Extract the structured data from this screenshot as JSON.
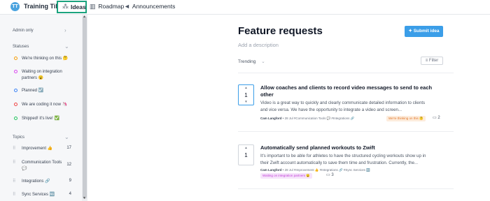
{
  "topbar": {
    "logo": "TT",
    "brand": "Training Tilt",
    "nav": [
      {
        "label": "Ideas",
        "icon": "sparkle-icon"
      },
      {
        "label": "Roadmap",
        "icon": "map-icon"
      },
      {
        "label": "Announcements",
        "icon": "megaphone-icon"
      }
    ]
  },
  "sidebar": {
    "admin_label": "Admin only",
    "statuses_title": "Statuses",
    "statuses": [
      {
        "label": "We're thinking on this 🤔",
        "color": "#f59e0b"
      },
      {
        "label": "Waiting on integration partners 😮",
        "color": "#d946ef"
      },
      {
        "label": "Planned ☑️",
        "color": "#3b82f6"
      },
      {
        "label": "We are coding it now 🦄",
        "color": "#ef4444"
      },
      {
        "label": "Shipped! it's live! ✅",
        "color": "#22c55e"
      }
    ],
    "topics_title": "Topics",
    "topics": [
      {
        "label": "Improvement 👍",
        "count": "17"
      },
      {
        "label": "Communication Tools 💬",
        "count": "12"
      },
      {
        "label": "Integrations 🔗",
        "count": "9"
      },
      {
        "label": "Sync Services 🆖",
        "count": "4"
      }
    ]
  },
  "main": {
    "title": "Feature requests",
    "description": "Add a description",
    "submit_label": "Submit idea",
    "sort_label": "Trending",
    "filter_label": "Filter",
    "posts": [
      {
        "votes": "1",
        "title": "Allow coaches and clients to record video messages to send to each other",
        "body": "Video is a great way to quickly and clearly communicate detailed information to clients and vice versa. We have the opportunity to integrate a video and screen...",
        "author": "Cam Langford",
        "date": "28 Jul",
        "tags": "#Communication Tools 💬  #Integrations 🔗",
        "status": "We're thinking on this 🤔",
        "status_color": "#f59e0b",
        "comments": "2"
      },
      {
        "votes": "1",
        "title": "Automatically send planned workouts to Zwift",
        "body": "It's important to be able for athletes to have the structured cycling workouts show up in their Zwift account automatically to save them time and frustration. Currently, the...",
        "author": "Cam Langford",
        "date": "28 Jul",
        "tags": "#Improvement 👍  #Integrations 🔗  #Sync Services 🆖",
        "status": "Waiting on integration partners 😮",
        "status_color": "#d946ef",
        "comments": "3"
      }
    ]
  }
}
